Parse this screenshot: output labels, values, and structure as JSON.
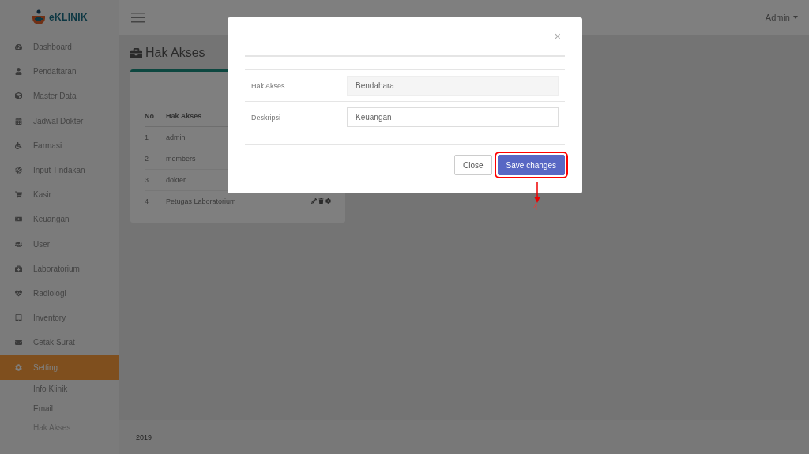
{
  "brand": {
    "name": "eKLINIK"
  },
  "user_menu": {
    "label": "Admin"
  },
  "sidebar": {
    "items": [
      {
        "label": "Dashboard",
        "selected": false
      },
      {
        "label": "Pendaftaran",
        "selected": false
      },
      {
        "label": "Master Data",
        "selected": false
      },
      {
        "label": "Jadwal Dokter",
        "selected": false
      },
      {
        "label": "Farmasi",
        "selected": false
      },
      {
        "label": "Input Tindakan",
        "selected": false
      },
      {
        "label": "Kasir",
        "selected": false
      },
      {
        "label": "Keuangan",
        "selected": false
      },
      {
        "label": "User",
        "selected": false
      },
      {
        "label": "Laboratorium",
        "selected": false
      },
      {
        "label": "Radiologi",
        "selected": false
      },
      {
        "label": "Inventory",
        "selected": false
      },
      {
        "label": "Cetak Surat",
        "selected": false
      },
      {
        "label": "Setting",
        "selected": true
      }
    ],
    "submenu": [
      {
        "label": "Info Klinik",
        "selected": false
      },
      {
        "label": "Email",
        "selected": false
      },
      {
        "label": "Hak Akses",
        "selected": true
      }
    ]
  },
  "page": {
    "title": "Hak Akses"
  },
  "table": {
    "columns": [
      "No",
      "Hak Akses"
    ],
    "rows": [
      {
        "no": "1",
        "name": "admin"
      },
      {
        "no": "2",
        "name": "members"
      },
      {
        "no": "3",
        "name": "dokter"
      },
      {
        "no": "4",
        "name": "Petugas Laboratorium",
        "actions_visible": true
      }
    ]
  },
  "footer": {
    "text": "2019"
  },
  "modal": {
    "close": "×",
    "fields": [
      {
        "label": "Hak Akses",
        "value": "Bendahara",
        "disabled": true
      },
      {
        "label": "Deskripsi",
        "value": "Keuangan",
        "disabled": false
      }
    ],
    "buttons": [
      {
        "label": "Close",
        "kind": "default"
      },
      {
        "label": "Save changes",
        "kind": "primary"
      }
    ]
  },
  "annotation": {
    "label": "4"
  }
}
